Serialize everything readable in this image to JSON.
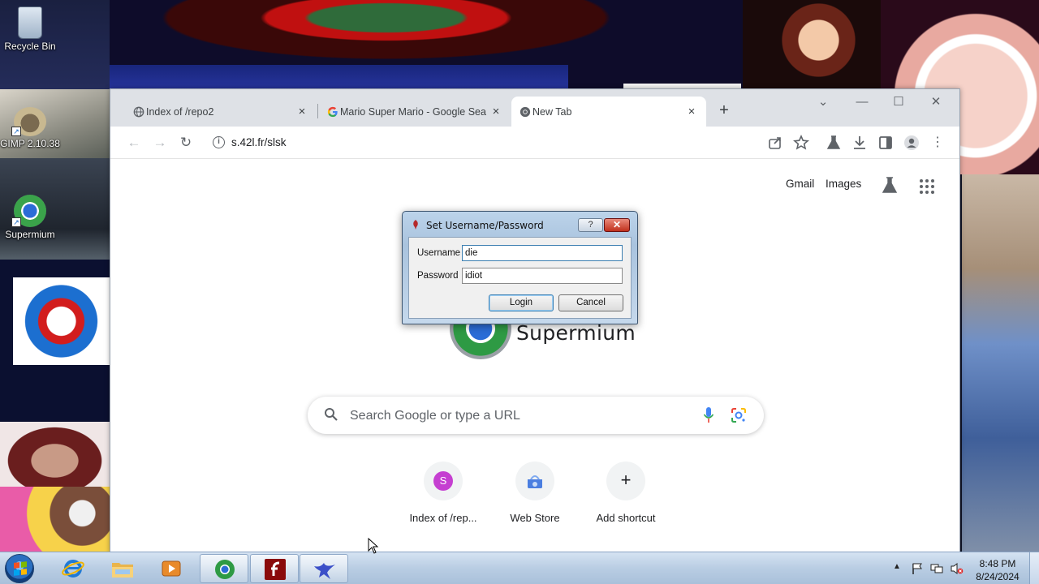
{
  "desktop": {
    "icons": [
      {
        "label": "Recycle Bin",
        "icon": "recycle-bin-icon"
      },
      {
        "label": "GIMP 2.10.38",
        "icon": "gimp-icon"
      },
      {
        "label": "Supermium",
        "icon": "supermium-icon"
      }
    ]
  },
  "browser": {
    "tabs": [
      {
        "title": "Index of /repo2",
        "icon": "globe-icon",
        "close": "×"
      },
      {
        "title": "Mario Super Mario - Google Sea",
        "icon": "google-icon",
        "close": "×"
      },
      {
        "title": "New Tab",
        "icon": "chrome-icon",
        "close": "×"
      }
    ],
    "new_tab": "+",
    "window_controls": {
      "dropdown": "⌄",
      "minimize": "—",
      "maximize": "☐",
      "close": "✕"
    },
    "toolbar": {
      "back": "←",
      "forward": "→",
      "reload": "↻",
      "url": "s.42l.fr/slsk",
      "info": "i"
    },
    "ntp": {
      "top_links": [
        "Gmail",
        "Images"
      ],
      "logo_text": "Supermium",
      "search_placeholder": "Search Google or type a URL",
      "shortcuts": [
        {
          "label": "Index of /rep...",
          "initial": "S",
          "color": "#c53fd1"
        },
        {
          "label": "Web Store",
          "initial": "",
          "color": "#4a7ee0"
        },
        {
          "label": "Add shortcut",
          "initial": "+",
          "color": ""
        }
      ]
    }
  },
  "dialog": {
    "title": "Set Username/Password",
    "help": "?",
    "close": "✕",
    "username_label": "Username",
    "username_value": "die",
    "password_label": "Password",
    "password_value": "idiot",
    "login_button": "Login",
    "cancel_button": "Cancel"
  },
  "taskbar": {
    "apps": [
      "internet-explorer-icon",
      "file-explorer-icon",
      "media-player-icon",
      "supermium-icon",
      "flash-icon",
      "app-bird-icon"
    ],
    "clock_time": "8:48 PM",
    "clock_date": "8/24/2024"
  }
}
